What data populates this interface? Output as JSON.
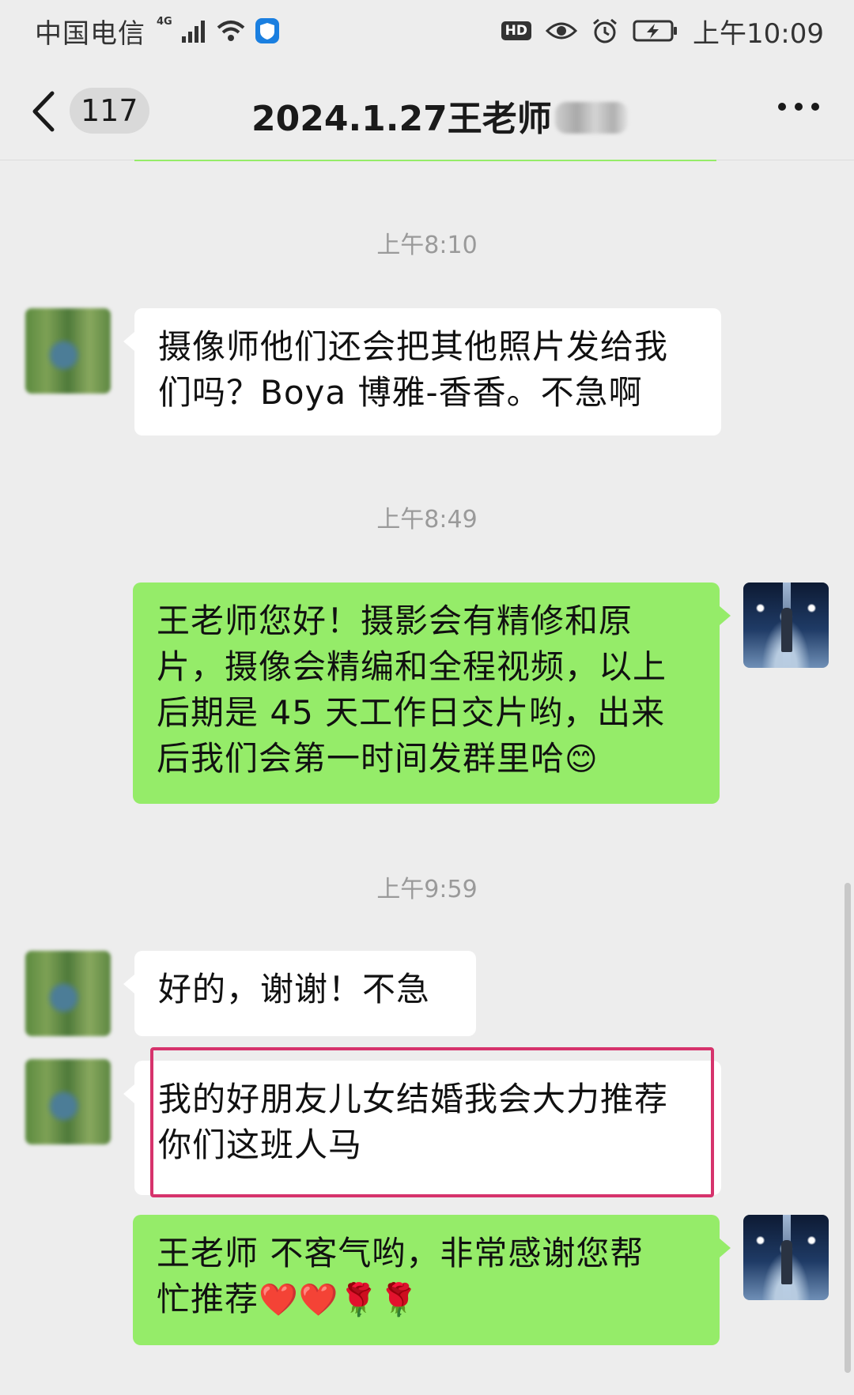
{
  "status_bar": {
    "carrier": "中国电信",
    "network": "4G",
    "hd": "HD",
    "time": "上午10:09"
  },
  "nav": {
    "unread_count": "117",
    "title": "2024.1.27王老师"
  },
  "messages": [
    {
      "type": "timestamp",
      "text": "上午8:10"
    },
    {
      "type": "incoming",
      "lines": [
        "摄像师他们还会把其他照片发给我",
        "们吗？Boya 博雅-香香。不急啊"
      ]
    },
    {
      "type": "timestamp",
      "text": "上午8:49"
    },
    {
      "type": "outgoing",
      "lines": [
        "王老师您好！摄影会有精修和原",
        "片，摄像会精编和全程视频，以上",
        "后期是 45 天工作日交片哟，出来",
        "后我们会第一时间发群里哈"
      ],
      "emoji": "😊"
    },
    {
      "type": "timestamp",
      "text": "上午9:59"
    },
    {
      "type": "incoming",
      "lines": [
        "好的，谢谢！不急"
      ]
    },
    {
      "type": "incoming",
      "lines": [
        "我的好朋友儿女结婚我会大力推荐",
        "你们这班人马"
      ],
      "highlighted": true
    },
    {
      "type": "outgoing",
      "lines": [
        "王老师 不客气哟，非常感谢您帮",
        "忙推荐"
      ],
      "emoji": "❤️❤️🌹🌹"
    }
  ],
  "colors": {
    "background": "#ededed",
    "outgoing_bubble": "#95ec69",
    "incoming_bubble": "#ffffff",
    "highlight_border": "#d6336c"
  }
}
